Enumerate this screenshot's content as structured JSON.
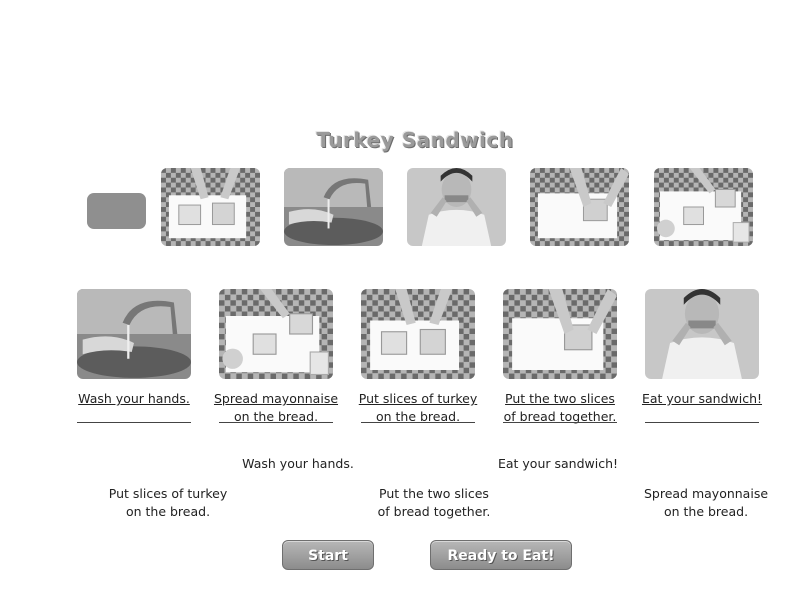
{
  "title": "Turkey Sandwich",
  "top_row": [
    {
      "icon": "putting-turkey-photo"
    },
    {
      "icon": "washing-hands-photo"
    },
    {
      "icon": "boy-eating-photo"
    },
    {
      "icon": "pressing-bread-photo"
    },
    {
      "icon": "spreading-mayo-photo"
    }
  ],
  "steps": [
    {
      "icon": "washing-hands-photo",
      "line1": "Wash your hands.",
      "line2": ""
    },
    {
      "icon": "spreading-mayo-photo",
      "line1": "Spread mayonnaise",
      "line2": "on the bread."
    },
    {
      "icon": "putting-turkey-photo",
      "line1": "Put slices of turkey",
      "line2": "on the bread."
    },
    {
      "icon": "pressing-bread-photo",
      "line1": "Put the two slices",
      "line2": "of bread together."
    },
    {
      "icon": "boy-eating-photo",
      "line1": "Eat your sandwich!",
      "line2": ""
    }
  ],
  "options": [
    {
      "line1": "Wash your hands.",
      "line2": ""
    },
    {
      "line1": "Eat your sandwich!",
      "line2": ""
    },
    {
      "line1": "Put slices of turkey",
      "line2": "on the bread."
    },
    {
      "line1": "Put the two slices",
      "line2": "of bread together."
    },
    {
      "line1": "Spread mayonnaise",
      "line2": "on the bread."
    }
  ],
  "buttons": {
    "start": "Start",
    "ready": "Ready to Eat!"
  }
}
